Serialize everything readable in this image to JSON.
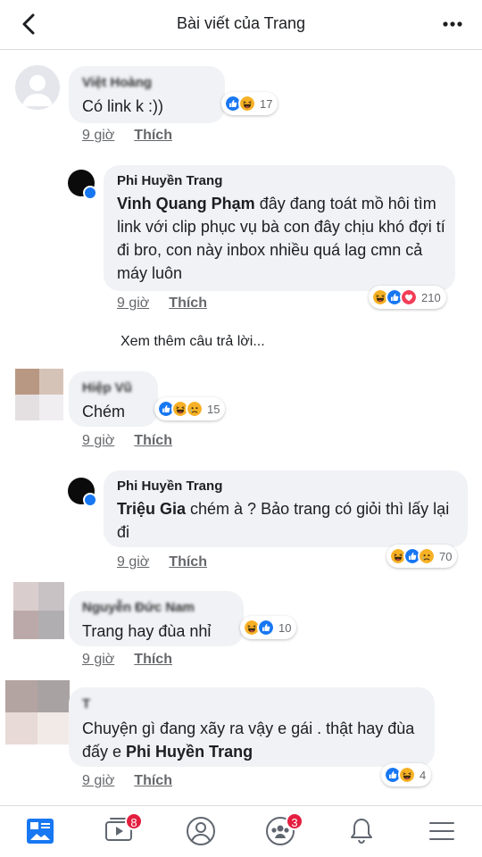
{
  "header": {
    "title": "Bài viết của Trang",
    "back_icon": "arrow-left-icon",
    "more_icon": "ellipsis-icon"
  },
  "comments": [
    {
      "author": "Việt Hoàng",
      "text": "Có link k :))",
      "time": "9 giờ",
      "like": "Thích",
      "reaction_count": "17",
      "reactions": [
        "like",
        "haha"
      ]
    },
    {
      "author": "Phi Huyền Trang",
      "mention": "Vinh Quang Phạm",
      "text": "  đây đang toát mồ hôi tìm link với clip phục vụ bà con đây chịu khó đợi tí đi bro, con này inbox nhiều quá lag cmn cả máy luôn",
      "time": "9 giờ",
      "like": "Thích",
      "reaction_count": "210",
      "reactions": [
        "haha",
        "like",
        "love"
      ]
    },
    {
      "author": "Hiệp Vũ",
      "text": "Chém",
      "time": "9 giờ",
      "like": "Thích",
      "reaction_count": "15",
      "reactions": [
        "like",
        "haha",
        "sad"
      ]
    },
    {
      "author": "Phi Huyền Trang",
      "mention": "Triệu Gia",
      "text": "  chém à ? Bảo trang có giỏi thì lấy lại đi",
      "time": "9 giờ",
      "like": "Thích",
      "reaction_count": "70",
      "reactions": [
        "haha",
        "like",
        "sad"
      ]
    },
    {
      "author": "Nguyễn Đức Nam",
      "text": "Trang hay đùa nhỉ",
      "time": "9 giờ",
      "like": "Thích",
      "reaction_count": "10",
      "reactions": [
        "haha",
        "like"
      ]
    },
    {
      "author": "T",
      "text_before": "Chuyện gì đang xãy ra vậy e gái . thật hay đùa đấy e ",
      "mention": "Phi Huyền Trang",
      "time": "9 giờ",
      "like": "Thích",
      "reaction_count": "4",
      "reactions": [
        "like",
        "haha"
      ]
    }
  ],
  "more_replies": "Xem thêm câu trả lời...",
  "tabbar": {
    "tabs": [
      "news-feed-icon",
      "watch-icon",
      "profile-icon",
      "groups-icon",
      "notifications-icon",
      "menu-icon"
    ],
    "watch_badge": "8",
    "groups_badge": "3"
  },
  "colors": {
    "accent": "#1877f2",
    "bubble": "#f0f2f5",
    "badge": "#e41e3f",
    "meta": "#65676b"
  }
}
